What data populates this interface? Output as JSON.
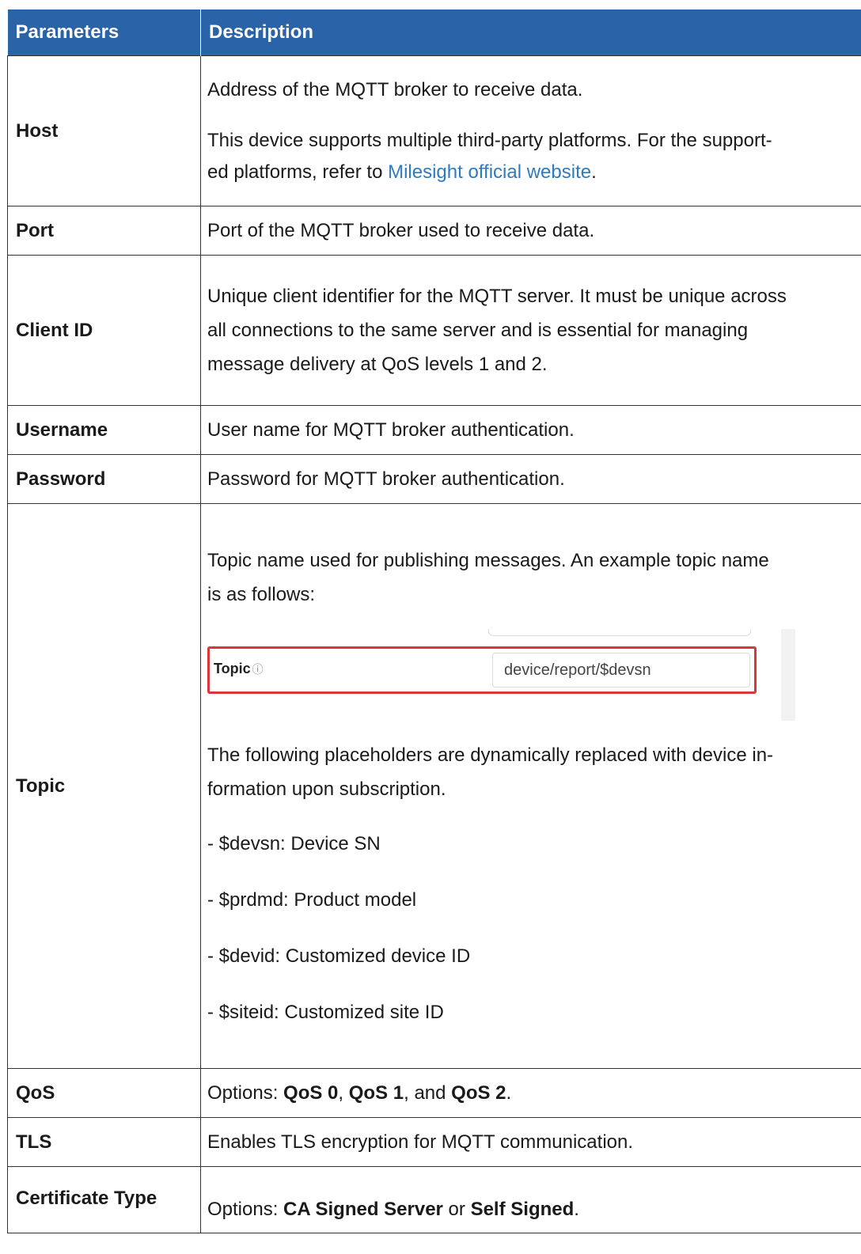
{
  "header": {
    "col1": "Parameters",
    "col2": "Description"
  },
  "rows": {
    "host": {
      "name": "Host",
      "line1": "Address of the MQTT broker to receive data.",
      "line2a": "This device supports multiple third-party platforms. For the support-",
      "line2b": "ed platforms, refer to ",
      "link": "Milesight official website",
      "line2c": "."
    },
    "port": {
      "name": "Port",
      "desc": "Port of the MQTT broker used to receive data."
    },
    "client_id": {
      "name": "Client ID",
      "line1": "Unique client identifier for the MQTT server. It must be unique across",
      "line2": "all connections to the same server and is essential for managing",
      "line3": "message delivery at QoS levels 1 and 2."
    },
    "username": {
      "name": "Username",
      "desc": "User name for MQTT broker authentication."
    },
    "password": {
      "name": "Password",
      "desc": "Password for MQTT broker authentication."
    },
    "topic": {
      "name": "Topic",
      "intro1": "Topic name used for publishing messages. An example topic name",
      "intro2": "is as follows:",
      "shot_label": "Topic",
      "shot_info": "ⓘ",
      "shot_value": "device/report/$devsn",
      "after1": "The following placeholders are dynamically replaced with device in-",
      "after2": "formation upon subscription.",
      "items": [
        "- $devsn: Device SN",
        "- $prdmd: Product model",
        "- $devid: Customized device ID",
        "- $siteid: Customized site ID"
      ]
    },
    "qos": {
      "name": "QoS",
      "prefix": "Options: ",
      "opt1": "QoS 0",
      "sep1": ", ",
      "opt2": "QoS 1",
      "sep2": ", and ",
      "opt3": "QoS 2",
      "suffix": "."
    },
    "tls": {
      "name": "TLS",
      "desc": "Enables TLS encryption for MQTT communication."
    },
    "cert": {
      "name": "Certificate Type",
      "prefix": "Options: ",
      "opt1": "CA Signed Server",
      "sep": " or ",
      "opt2": "Self Signed",
      "suffix": "."
    }
  }
}
